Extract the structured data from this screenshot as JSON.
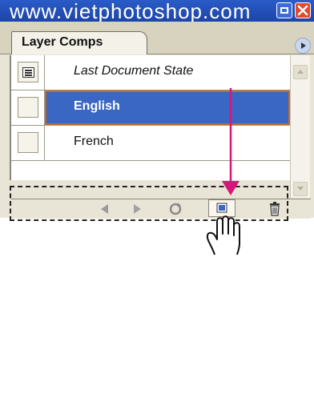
{
  "window": {
    "title": "www.vietphotoshop.com"
  },
  "panel": {
    "tab_label": "Layer Comps"
  },
  "layer_comps": [
    {
      "label": "Last Document State",
      "selected": false
    },
    {
      "label": "English",
      "selected": true
    },
    {
      "label": "French",
      "selected": false
    }
  ],
  "bottom_toolbar": {
    "buttons": [
      "previous-icon",
      "next-icon",
      "update-icon",
      "new-layer-comp-icon",
      "trash-icon"
    ]
  },
  "colors": {
    "title_bar": "#2a5bc7",
    "selection": "#3a66c4",
    "selection_outline": "#c26a2c",
    "annotation_arrow": "#d6177a"
  }
}
